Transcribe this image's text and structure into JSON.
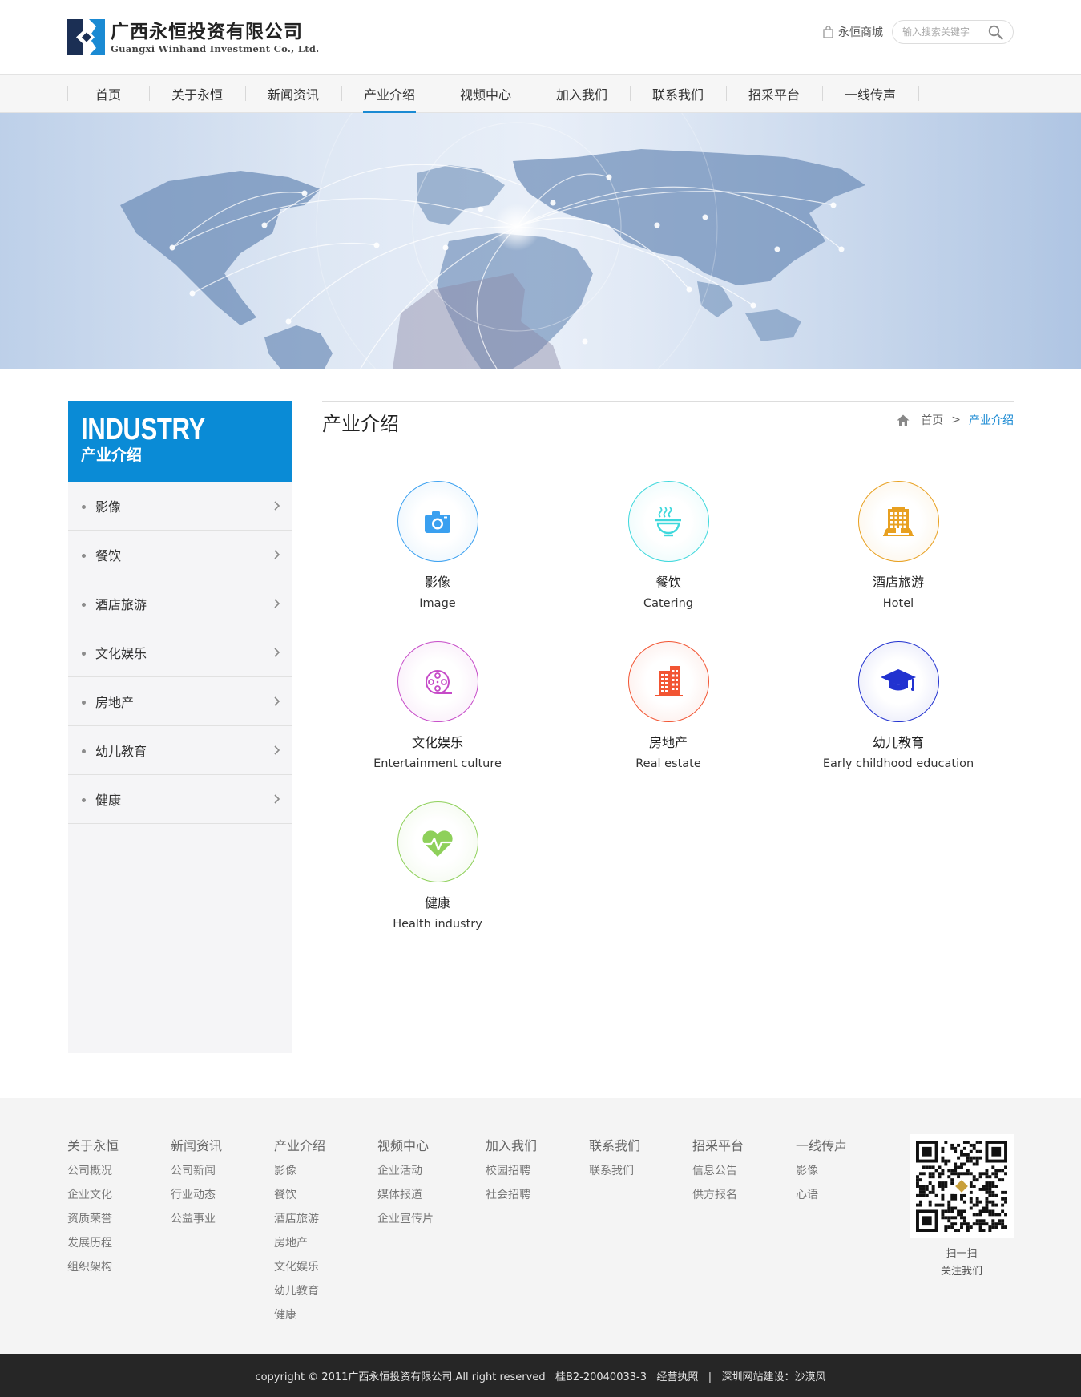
{
  "brand": {
    "name_cn": "广西永恒投资有限公司",
    "name_en": "Guangxi Winhand Investment Co., Ltd."
  },
  "header": {
    "mall_label": "永恒商城",
    "search_placeholder": "输入搜索关键字"
  },
  "nav": {
    "items": [
      "首页",
      "关于永恒",
      "新闻资讯",
      "产业介绍",
      "视频中心",
      "加入我们",
      "联系我们",
      "招采平台",
      "一线传声"
    ],
    "active_index": 3,
    "accent_color": "#1a8ad3"
  },
  "sidebar": {
    "title_en": "INDUSTRY",
    "title_cn": "产业介绍",
    "header_color": "#0a8bd6",
    "items": [
      "影像",
      "餐饮",
      "酒店旅游",
      "文化娱乐",
      "房地产",
      "幼儿教育",
      "健康"
    ]
  },
  "main": {
    "title": "产业介绍",
    "breadcrumb": {
      "home": "首页",
      "separator": ">",
      "current": "产业介绍"
    },
    "industries": [
      {
        "cn": "影像",
        "en": "Image",
        "icon": "camera-icon",
        "color": "#3aa0f0"
      },
      {
        "cn": "餐饮",
        "en": "Catering",
        "icon": "noodle-bowl-icon",
        "color": "#3ed8dc"
      },
      {
        "cn": "酒店旅游",
        "en": "Hotel",
        "icon": "hotel-icon",
        "color": "#e8a020"
      },
      {
        "cn": "文化娱乐",
        "en": "Entertainment culture",
        "icon": "film-reel-icon",
        "color": "#c64bc8"
      },
      {
        "cn": "房地产",
        "en": "Real estate",
        "icon": "building-icon",
        "color": "#f25533"
      },
      {
        "cn": "幼儿教育",
        "en": "Early childhood education",
        "icon": "graduation-cap-icon",
        "color": "#2232d0"
      },
      {
        "cn": "健康",
        "en": "Health industry",
        "icon": "heartbeat-icon",
        "color": "#8ed05a"
      }
    ]
  },
  "footer": {
    "columns": [
      {
        "title": "关于永恒",
        "links": [
          "公司概况",
          "企业文化",
          "资质荣誉",
          "发展历程",
          "组织架构"
        ]
      },
      {
        "title": "新闻资讯",
        "links": [
          "公司新闻",
          "行业动态",
          "公益事业"
        ]
      },
      {
        "title": "产业介绍",
        "links": [
          "影像",
          "餐饮",
          "酒店旅游",
          "房地产",
          "文化娱乐",
          "幼儿教育",
          "健康"
        ]
      },
      {
        "title": "视频中心",
        "links": [
          "企业活动",
          "媒体报道",
          "企业宣传片"
        ]
      },
      {
        "title": "加入我们",
        "links": [
          "校园招聘",
          "社会招聘"
        ]
      },
      {
        "title": "联系我们",
        "links": [
          "联系我们"
        ]
      },
      {
        "title": "招采平台",
        "links": [
          "信息公告",
          "供方报名"
        ]
      },
      {
        "title": "一线传声",
        "links": [
          "影像",
          "心语"
        ]
      }
    ],
    "qr_caption_1": "扫一扫",
    "qr_caption_2": "关注我们",
    "copyright": "copyright © 2011广西永恒投资有限公司.All right reserved   桂B2-20040033-3   经营执照   |   深圳网站建设：沙漠风"
  }
}
